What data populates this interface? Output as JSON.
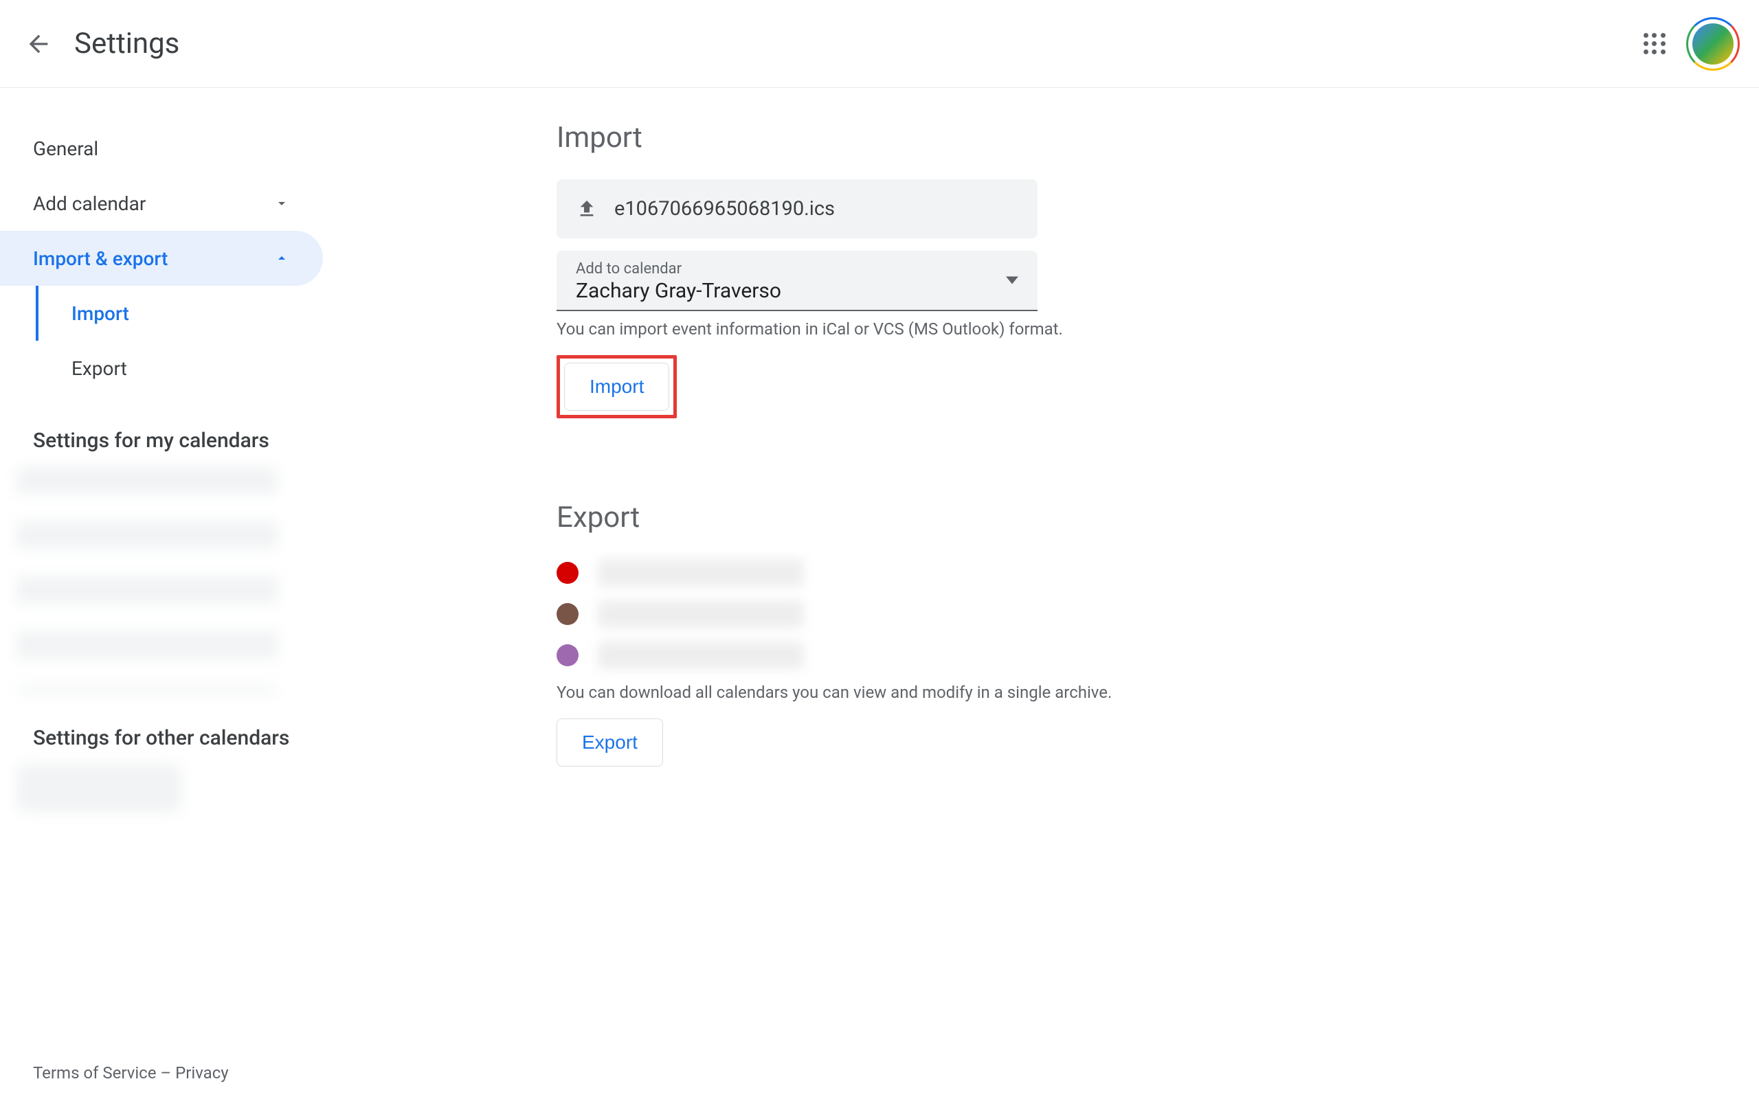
{
  "header": {
    "title": "Settings"
  },
  "sidebar": {
    "items": [
      {
        "label": "General"
      },
      {
        "label": "Add calendar"
      },
      {
        "label": "Import & export"
      }
    ],
    "subitems": [
      {
        "label": "Import"
      },
      {
        "label": "Export"
      }
    ],
    "section_my": "Settings for my calendars",
    "section_other": "Settings for other calendars"
  },
  "import": {
    "title": "Import",
    "filename": "e1067066965068190.ics",
    "add_to_label": "Add to calendar",
    "add_to_value": "Zachary Gray-Traverso",
    "hint": "You can import event information in iCal or VCS (MS Outlook) format.",
    "button": "Import"
  },
  "export": {
    "title": "Export",
    "calendars": [
      {
        "color": "#d50000"
      },
      {
        "color": "#795548"
      },
      {
        "color": "#9e69af"
      }
    ],
    "hint": "You can download all calendars you can view and modify in a single archive.",
    "button": "Export"
  },
  "footer": {
    "terms": "Terms of Service",
    "sep": " – ",
    "privacy": "Privacy"
  }
}
